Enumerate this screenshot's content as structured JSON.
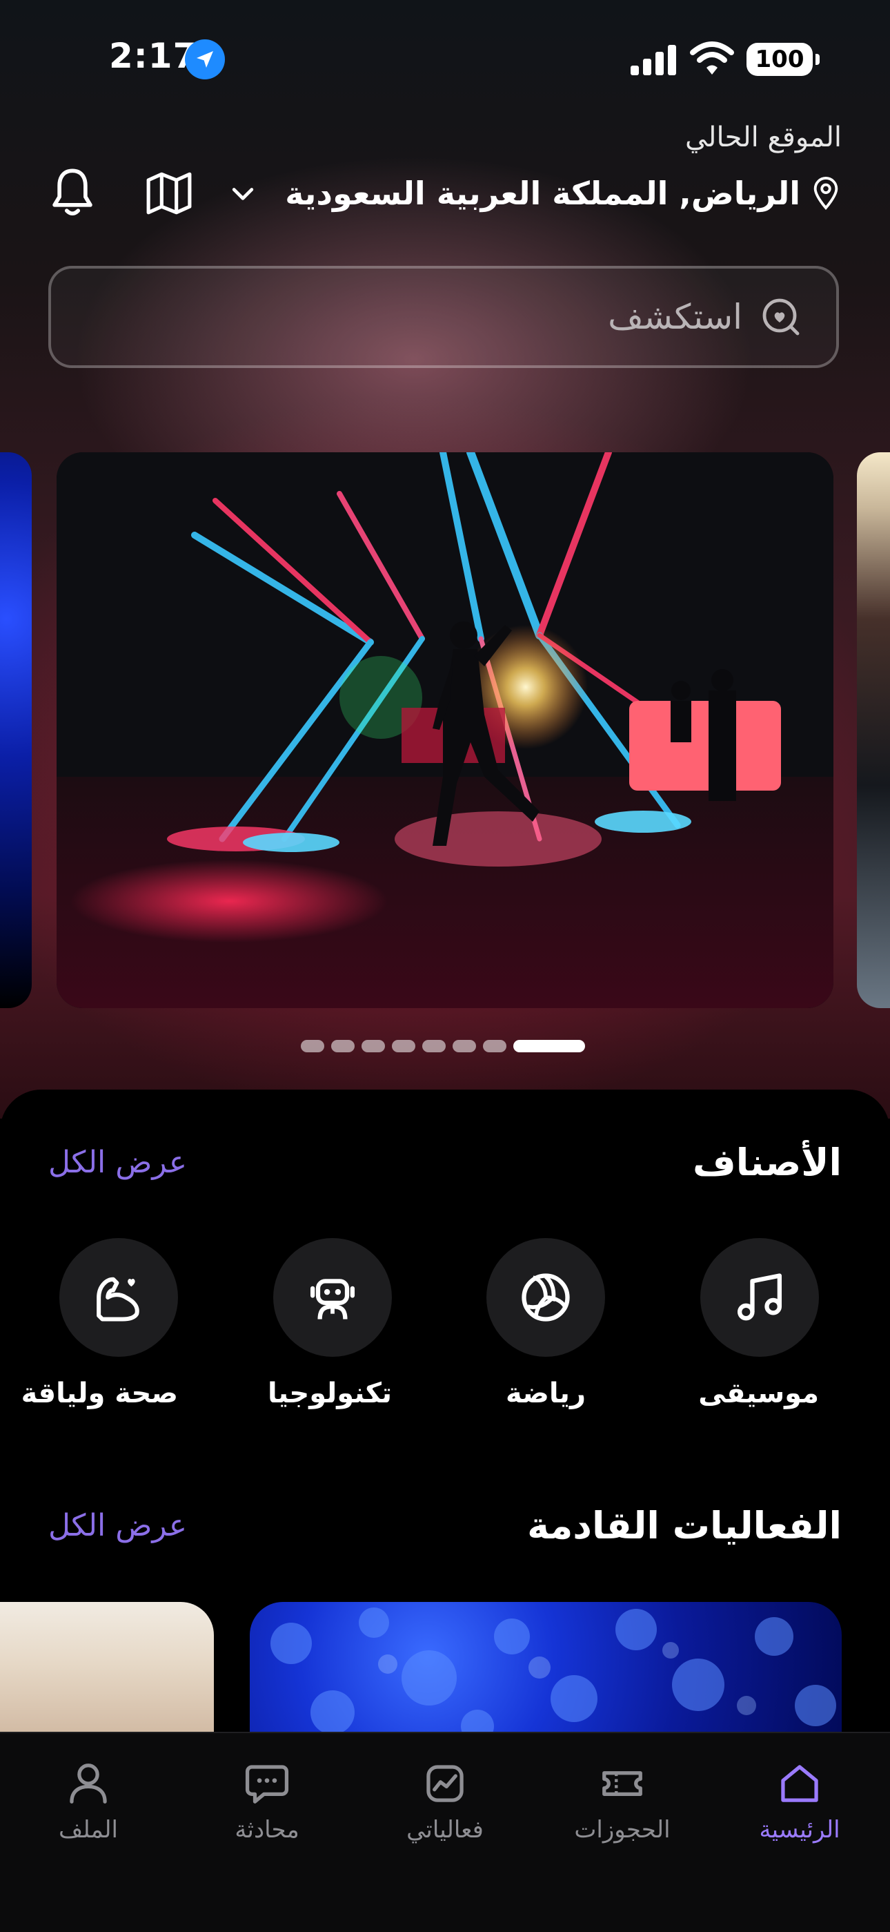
{
  "status_bar": {
    "time": "2:17",
    "battery": "100"
  },
  "location": {
    "label": "الموقع الحالي",
    "value": "الرياض, المملكة العربية السعودية"
  },
  "search": {
    "placeholder": "استكشف"
  },
  "carousel": {
    "total_slides": 8,
    "active_index": 7
  },
  "categories": {
    "title": "الأصناف",
    "view_all": "عرض الكل",
    "items": [
      {
        "label": "موسيقى",
        "icon": "music-note-icon"
      },
      {
        "label": "رياضة",
        "icon": "volleyball-icon"
      },
      {
        "label": "تكنولوجيا",
        "icon": "robot-icon"
      },
      {
        "label": "صحة ولياقة",
        "icon": "muscle-heart-icon"
      }
    ]
  },
  "upcoming": {
    "title": "الفعاليات القادمة",
    "view_all": "عرض الكل"
  },
  "tabbar": {
    "items": [
      {
        "label": "الرئيسية",
        "icon": "home-icon",
        "active": true
      },
      {
        "label": "الحجوزات",
        "icon": "ticket-icon",
        "active": false
      },
      {
        "label": "فعالياتي",
        "icon": "activity-chart-icon",
        "active": false
      },
      {
        "label": "محادثة",
        "icon": "chat-bubble-icon",
        "active": false
      },
      {
        "label": "الملف",
        "icon": "profile-icon",
        "active": false
      }
    ]
  },
  "colors": {
    "accent": "#8b6fe8",
    "accent_active": "#9b7bff",
    "location_blue": "#1e8bff"
  }
}
